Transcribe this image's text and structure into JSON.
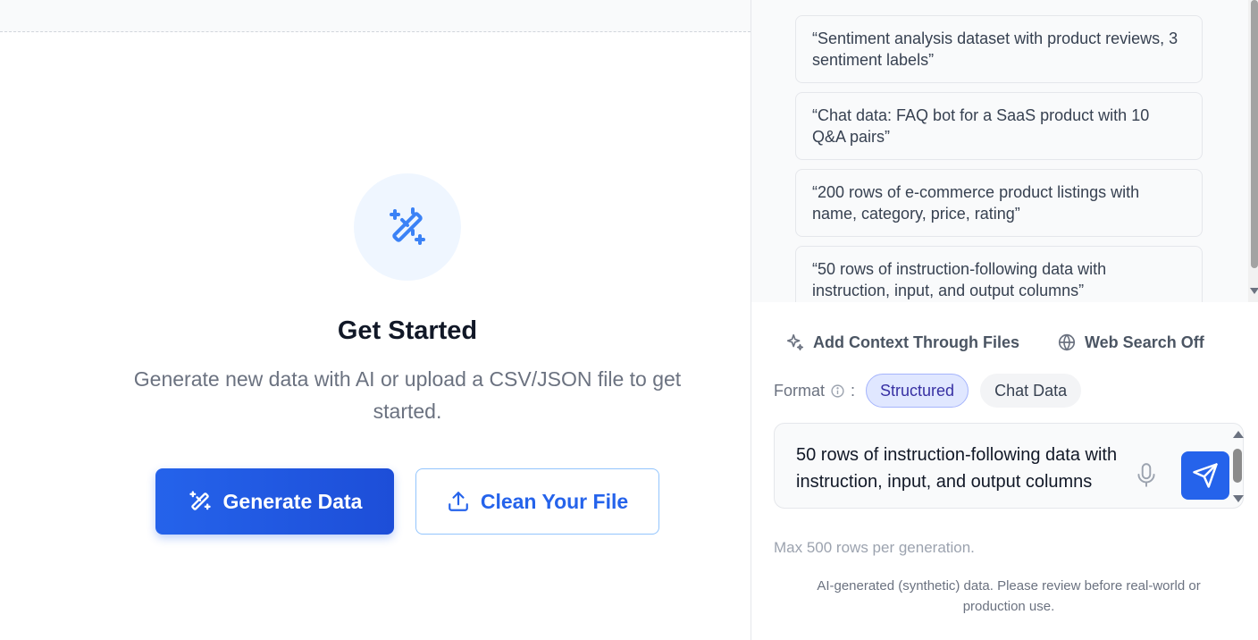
{
  "main": {
    "title": "Get Started",
    "subtitle": "Generate new data with AI or upload a CSV/JSON file to get started.",
    "generate_button": "Generate Data",
    "clean_button": "Clean Your File",
    "hero_icon": "magic-wand-icon"
  },
  "panel": {
    "suggestions": [
      "“Sentiment analysis dataset with product reviews, 3 sentiment labels”",
      "“Chat data: FAQ bot for a SaaS product with 10 Q&A pairs”",
      "“200 rows of e-commerce product listings with name, category, price, rating”",
      "“50 rows of instruction-following data with instruction, input, and output columns”"
    ],
    "tools": {
      "context": "Add Context Through Files",
      "web_search": "Web Search Off"
    },
    "format": {
      "label": "Format",
      "separator": ":",
      "options": [
        "Structured",
        "Chat Data"
      ],
      "selected": "Structured"
    },
    "input_value": "50 rows of instruction-following data with instruction, input, and output columns",
    "max_rows": "Max 500 rows per generation.",
    "disclaimer": "AI-generated (synthetic) data. Please review before real-world or production use."
  },
  "colors": {
    "accent": "#2563eb",
    "chip_active_bg": "#e0e7ff",
    "chip_active_text": "#3730a3"
  }
}
